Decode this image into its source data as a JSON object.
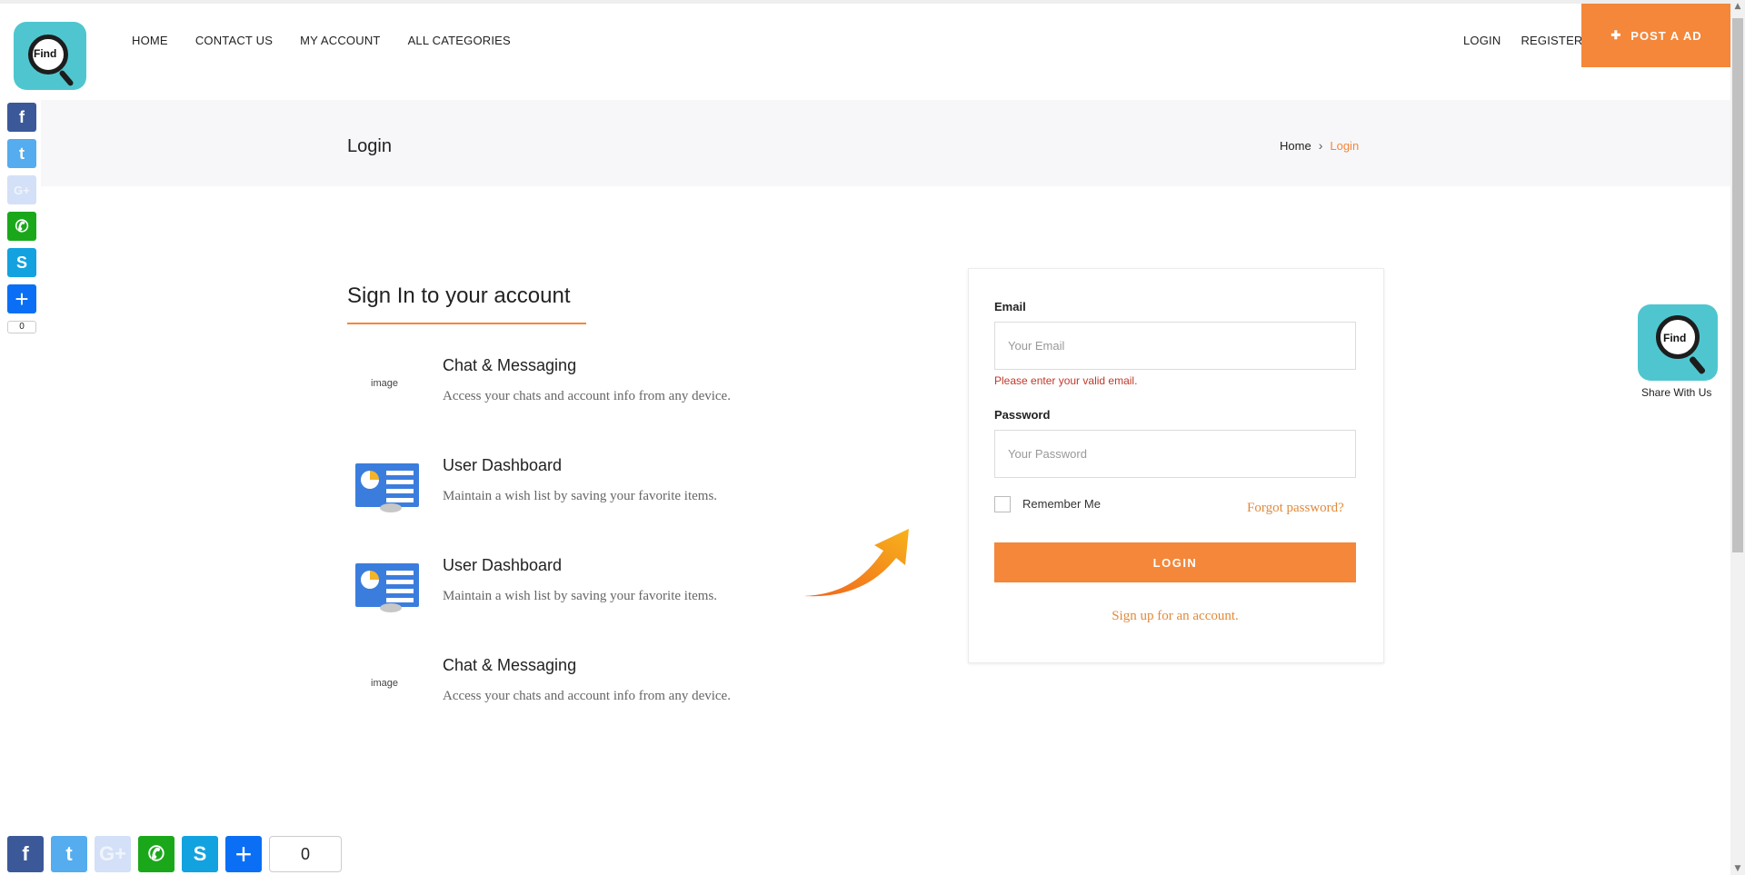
{
  "header": {
    "logo_text": "Find",
    "nav": [
      "HOME",
      "CONTACT US",
      "MY ACCOUNT",
      "ALL CATEGORIES"
    ],
    "login_label": "LOGIN",
    "register_label": "REGISTER",
    "post_ad_icon": "plus-icon",
    "post_ad_label": "POST A AD"
  },
  "banner": {
    "title": "Login",
    "breadcrumb_home": "Home",
    "breadcrumb_separator": "›",
    "breadcrumb_current": "Login"
  },
  "intro": {
    "heading": "Sign In to your account",
    "features": [
      {
        "title": "Chat & Messaging",
        "desc": "Access your chats and account info from any device.",
        "image_alt": "image"
      },
      {
        "title": "User Dashboard",
        "desc": "Maintain a wish list by saving your favorite items."
      },
      {
        "title": "User Dashboard",
        "desc": "Maintain a wish list by saving your favorite items."
      },
      {
        "title": "Chat & Messaging",
        "desc": "Access your chats and account info from any device.",
        "image_alt": "image"
      }
    ]
  },
  "form": {
    "email_label": "Email",
    "email_placeholder": "Your Email",
    "email_error": "Please enter your valid email.",
    "password_label": "Password",
    "password_placeholder": "Your Password",
    "remember_label": "Remember Me",
    "forgot_label": "Forgot password?",
    "login_button": "LOGIN",
    "signup_link": "Sign up for an account."
  },
  "share": {
    "side_count": "0",
    "bottom_count": "0",
    "google_plus_label": "G+",
    "icons": [
      "facebook-icon",
      "twitter-icon",
      "google-plus-icon",
      "whatsapp-icon",
      "skype-icon",
      "add-share-icon"
    ],
    "widget_label": "Share With Us",
    "widget_text": "Find"
  },
  "colors": {
    "accent": "#f4873a",
    "link": "#e08a3c",
    "error": "#c0392b",
    "banner_bg": "#f7f7f9"
  }
}
